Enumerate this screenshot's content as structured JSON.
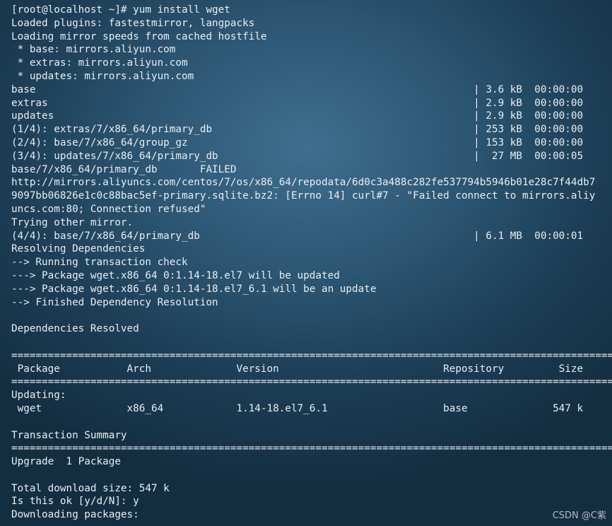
{
  "terminal": {
    "lines": [
      "[root@localhost ~]# yum install wget",
      "Loaded plugins: fastestmirror, langpacks",
      "Loading mirror speeds from cached hostfile",
      " * base: mirrors.aliyun.com",
      " * extras: mirrors.aliyun.com",
      " * updates: mirrors.aliyun.com",
      "base                                                                        | 3.6 kB  00:00:00",
      "extras                                                                      | 2.9 kB  00:00:00",
      "updates                                                                     | 2.9 kB  00:00:00",
      "(1/4): extras/7/x86_64/primary_db                                           | 253 kB  00:00:00",
      "(2/4): base/7/x86_64/group_gz                                               | 153 kB  00:00:00",
      "(3/4): updates/7/x86_64/primary_db                                          |  27 MB  00:00:05",
      "base/7/x86_64/primary_db       FAILED",
      "http://mirrors.aliyuncs.com/centos/7/os/x86_64/repodata/6d0c3a488c282fe537794b5946b01e28c7f44db7",
      "9097bb06826e1c0c88bac5ef-primary.sqlite.bz2: [Errno 14] curl#7 - \"Failed connect to mirrors.aliy",
      "uncs.com:80; Connection refused\"",
      "Trying other mirror.",
      "(4/4): base/7/x86_64/primary_db                                             | 6.1 MB  00:00:01",
      "Resolving Dependencies",
      "--> Running transaction check",
      "---> Package wget.x86_64 0:1.14-18.el7 will be updated",
      "---> Package wget.x86_64 0:1.14-18.el7_6.1 will be an update",
      "--> Finished Dependency Resolution",
      "",
      "Dependencies Resolved",
      "",
      "====================================================================================================",
      " Package           Arch              Version                           Repository         Size",
      "====================================================================================================",
      "Updating:",
      " wget              x86_64            1.14-18.el7_6.1                   base              547 k",
      "",
      "Transaction Summary",
      "====================================================================================================",
      "Upgrade  1 Package",
      "",
      "Total download size: 547 k",
      "Is this ok [y/d/N]: y",
      "Downloading packages:"
    ]
  },
  "watermark": "CSDN @C紫"
}
